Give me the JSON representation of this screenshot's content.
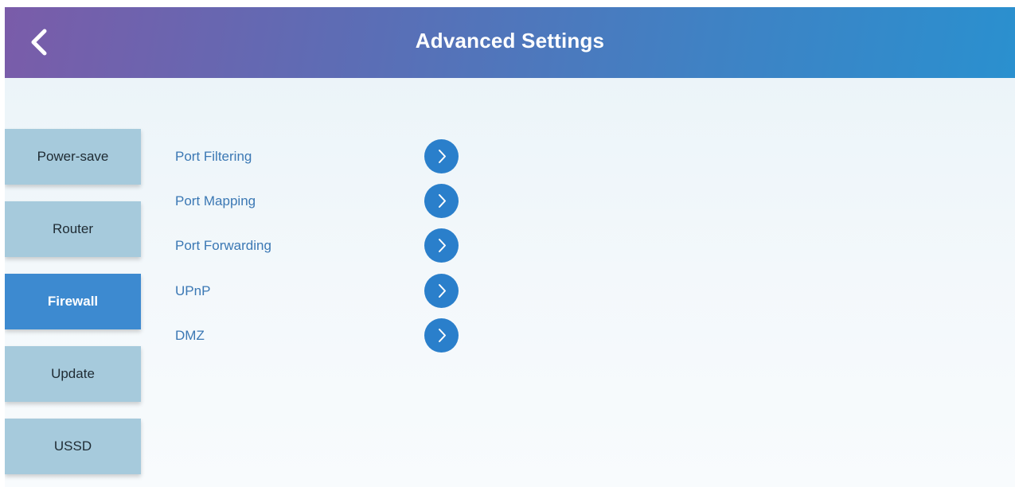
{
  "header": {
    "title": "Advanced Settings",
    "back_icon": "chevron-left-icon"
  },
  "sidebar": {
    "items": [
      {
        "label": "Power-save",
        "active": false
      },
      {
        "label": "Router",
        "active": false
      },
      {
        "label": "Firewall",
        "active": true
      },
      {
        "label": "Update",
        "active": false
      },
      {
        "label": "USSD",
        "active": false
      }
    ]
  },
  "firewall_menu": {
    "items": [
      {
        "label": "Port Filtering",
        "icon": "chevron-right-icon"
      },
      {
        "label": "Port Mapping",
        "icon": "chevron-right-icon"
      },
      {
        "label": "Port Forwarding",
        "icon": "chevron-right-icon"
      },
      {
        "label": "UPnP",
        "icon": "chevron-right-icon"
      },
      {
        "label": "DMZ",
        "icon": "chevron-right-icon"
      }
    ]
  },
  "colors": {
    "header_gradient_start": "#7a5ca9",
    "header_gradient_end": "#2a90cf",
    "tab_inactive": "#a6cadc",
    "tab_active": "#3d8ad0",
    "menu_label": "#3b78b4",
    "arrow_button": "#2a7fcb"
  }
}
